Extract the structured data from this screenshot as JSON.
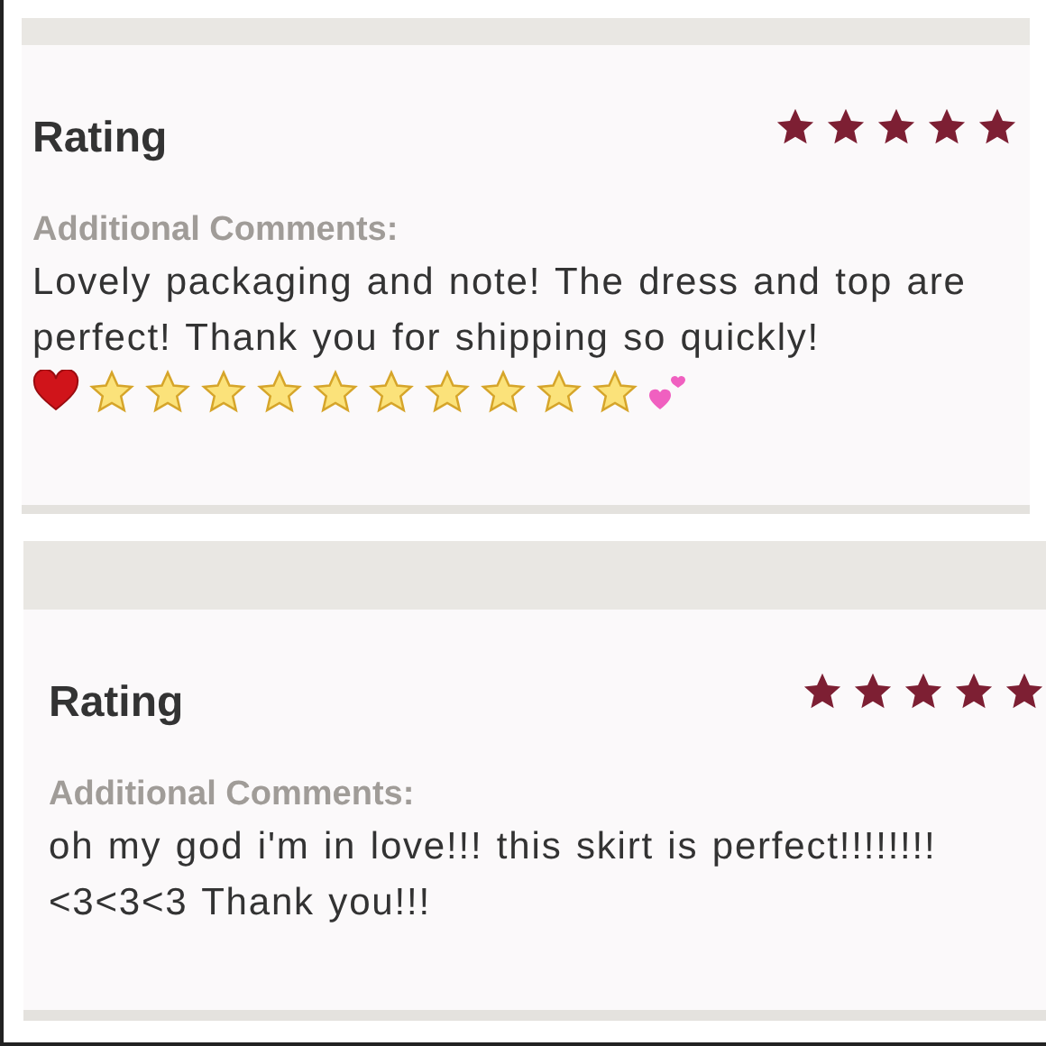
{
  "reviews": [
    {
      "rating_label": "Rating",
      "stars": 5,
      "comments_label": "Additional Comments:",
      "comment": "Lovely packaging and note! The dress and top are perfect! Thank you for shipping so quickly!",
      "emoji": [
        {
          "kind": "heart"
        },
        {
          "kind": "star"
        },
        {
          "kind": "star"
        },
        {
          "kind": "star"
        },
        {
          "kind": "star"
        },
        {
          "kind": "star"
        },
        {
          "kind": "star"
        },
        {
          "kind": "star"
        },
        {
          "kind": "star"
        },
        {
          "kind": "star"
        },
        {
          "kind": "star"
        },
        {
          "kind": "hearts"
        }
      ]
    },
    {
      "rating_label": "Rating",
      "stars": 5,
      "comments_label": "Additional Comments:",
      "comment": "oh my god i'm in love!!! this skirt is perfect!!!!!!!! <3<3<3 Thank you!!!"
    }
  ]
}
